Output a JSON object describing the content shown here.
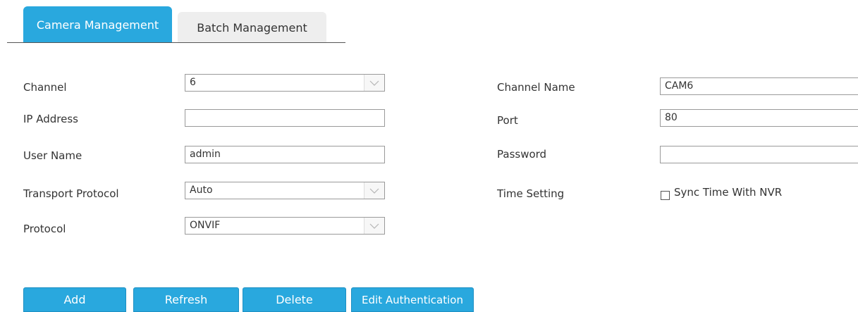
{
  "tabs": [
    {
      "label": "Camera Management",
      "active": true
    },
    {
      "label": "Batch Management",
      "active": false
    }
  ],
  "form": {
    "channel": {
      "label": "Channel",
      "value": "6"
    },
    "ip_address": {
      "label": "IP Address",
      "value": ""
    },
    "user_name": {
      "label": "User Name",
      "value": "admin"
    },
    "transport_protocol": {
      "label": "Transport Protocol",
      "value": "Auto"
    },
    "protocol": {
      "label": "Protocol",
      "value": "ONVIF"
    },
    "channel_name": {
      "label": "Channel Name",
      "value": "CAM6"
    },
    "port": {
      "label": "Port",
      "value": "80"
    },
    "password": {
      "label": "Password",
      "value": ""
    },
    "time_setting": {
      "label": "Time Setting",
      "checkbox_label": "Sync Time With NVR",
      "checked": false
    }
  },
  "buttons": {
    "add": "Add",
    "refresh": "Refresh",
    "delete": "Delete",
    "edit_auth": "Edit Authentication"
  },
  "colors": {
    "accent": "#29a8de",
    "inactive_tab": "#eeeeee",
    "field_border": "#9a9a9a"
  },
  "icons": {
    "select_arrow": "chevron-down-icon"
  }
}
